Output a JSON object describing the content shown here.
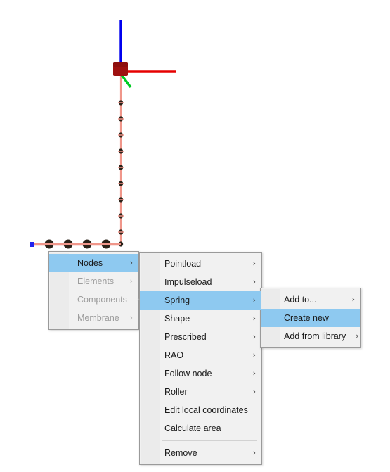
{
  "app": {
    "scene_description": "3D structural model viewport with coordinate axes and node chain"
  },
  "viewport": {
    "axes": [
      {
        "name": "z-axis",
        "color": "#0000ee",
        "label": ""
      },
      {
        "name": "x-axis",
        "color": "#e60000",
        "label": ""
      },
      {
        "name": "y-axis",
        "color": "#00cc22",
        "label": ""
      }
    ],
    "origin_block_color": "#9e1111",
    "member_color": "#f0968a",
    "node_marker_color": "#2b2118",
    "selected_node_color": "#2222ee",
    "vertical_node_count": 10,
    "horizontal_node_count": 4
  },
  "menus": {
    "nodes_menu": {
      "name": "element-type-menu",
      "items": [
        {
          "label": "Nodes",
          "submenu": true,
          "enabled": true,
          "highlighted": true
        },
        {
          "label": "Elements",
          "submenu": true,
          "enabled": false,
          "highlighted": false
        },
        {
          "label": "Components",
          "submenu": true,
          "enabled": false,
          "highlighted": false
        },
        {
          "label": "Membrane",
          "submenu": true,
          "enabled": false,
          "highlighted": false
        }
      ]
    },
    "spring_menu": {
      "name": "node-actions-menu",
      "items": [
        {
          "label": "Pointload",
          "submenu": true,
          "enabled": true,
          "highlighted": false,
          "separator_before": false
        },
        {
          "label": "Impulseload",
          "submenu": true,
          "enabled": true,
          "highlighted": false,
          "separator_before": false
        },
        {
          "label": "Spring",
          "submenu": true,
          "enabled": true,
          "highlighted": true,
          "separator_before": false
        },
        {
          "label": "Shape",
          "submenu": true,
          "enabled": true,
          "highlighted": false,
          "separator_before": false
        },
        {
          "label": "Prescribed",
          "submenu": true,
          "enabled": true,
          "highlighted": false,
          "separator_before": false
        },
        {
          "label": "RAO",
          "submenu": true,
          "enabled": true,
          "highlighted": false,
          "separator_before": false
        },
        {
          "label": "Follow node",
          "submenu": true,
          "enabled": true,
          "highlighted": false,
          "separator_before": false
        },
        {
          "label": "Roller",
          "submenu": true,
          "enabled": true,
          "highlighted": false,
          "separator_before": false
        },
        {
          "label": "Edit local coordinates",
          "submenu": false,
          "enabled": true,
          "highlighted": false,
          "separator_before": false
        },
        {
          "label": "Calculate area",
          "submenu": false,
          "enabled": true,
          "highlighted": false,
          "separator_before": false
        },
        {
          "label": "Remove",
          "submenu": true,
          "enabled": true,
          "highlighted": false,
          "separator_before": true
        }
      ]
    },
    "create_menu": {
      "name": "spring-create-menu",
      "items": [
        {
          "label": "Add to...",
          "submenu": true,
          "enabled": true,
          "highlighted": false
        },
        {
          "label": "Create new",
          "submenu": false,
          "enabled": true,
          "highlighted": true
        },
        {
          "label": "Add from library",
          "submenu": true,
          "enabled": true,
          "highlighted": false
        }
      ]
    }
  },
  "colors": {
    "menu_background": "#f1f1f1",
    "menu_border": "#9a9a9a",
    "menu_gutter": "#ebebeb",
    "highlight": "#8ec9f0",
    "text": "#1a1a1a",
    "text_disabled": "#9d9d9d",
    "separator": "#d2d2d2"
  },
  "icons": {
    "submenu_arrow": "›"
  }
}
